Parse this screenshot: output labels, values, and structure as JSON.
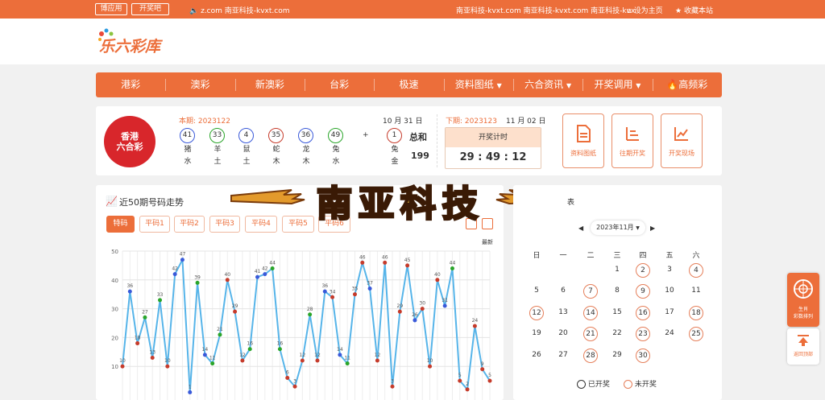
{
  "topbar": {
    "btn1": "博应用",
    "btn2": "开奖吧",
    "center_text": "z.com 南亚科技-kvxt.com",
    "right_text": "南亚科技-kvxt.com 南亚科技-kvxt.com 南亚科技-kvx",
    "set_home": "设为主页",
    "bookmark": "收藏本站"
  },
  "logo": {
    "text": "乐六彩库"
  },
  "nav": {
    "items": [
      "港彩",
      "澳彩",
      "新澳彩",
      "台彩",
      "极速",
      "资料图纸",
      "六合资讯",
      "开奖调用",
      "高频彩"
    ]
  },
  "draw": {
    "badge_line1": "香港",
    "badge_line2": "六合彩",
    "period_label": "本期: 2023122",
    "date": "10 月 31 日",
    "balls": [
      {
        "num": "41",
        "zodiac": "猪",
        "element": "水",
        "color": "blue"
      },
      {
        "num": "33",
        "zodiac": "羊",
        "element": "土",
        "color": "green"
      },
      {
        "num": "4",
        "zodiac": "鼠",
        "element": "土",
        "color": "blue"
      },
      {
        "num": "35",
        "zodiac": "蛇",
        "element": "木",
        "color": "red"
      },
      {
        "num": "36",
        "zodiac": "龙",
        "element": "木",
        "color": "blue"
      },
      {
        "num": "49",
        "zodiac": "兔",
        "element": "水",
        "color": "green"
      }
    ],
    "plus": "+",
    "special": {
      "num": "1",
      "zodiac": "兔",
      "element": "金",
      "color": "red"
    },
    "sum_label": "总和",
    "sum_value": "199",
    "next_period": "下期: 2023123",
    "next_date": "11 月 02 日",
    "countdown_label": "开奖计时",
    "countdown": "29 : 49 : 12"
  },
  "quick": [
    "资料图纸",
    "往期开奖",
    "开奖现场"
  ],
  "trend": {
    "title": "近50期号码走势",
    "tabs": [
      "特码",
      "平码1",
      "平码2",
      "平码3",
      "平码4",
      "平码5",
      "平码6"
    ],
    "latest": "最新"
  },
  "watermark": "南亚科技",
  "calendar": {
    "title_suffix": "表",
    "month": "2023年11月",
    "weekdays": [
      "日",
      "一",
      "二",
      "三",
      "四",
      "五",
      "六"
    ],
    "days": [
      [
        null,
        null,
        null,
        "1",
        "2",
        "3",
        "4"
      ],
      [
        "5",
        "6",
        "7",
        "8",
        "9",
        "10",
        "11"
      ],
      [
        "12",
        "13",
        "14",
        "15",
        "16",
        "17",
        "18"
      ],
      [
        "19",
        "20",
        "21",
        "22",
        "23",
        "24",
        "25"
      ],
      [
        "26",
        "27",
        "28",
        "29",
        "30",
        null,
        null
      ]
    ],
    "circled": [
      "2",
      "4",
      "7",
      "9",
      "12",
      "14",
      "16",
      "18",
      "21",
      "23",
      "25",
      "28",
      "30"
    ],
    "legend_open": "已开奖",
    "legend_pending": "未开奖"
  },
  "floats": {
    "item1_line1": "生肖",
    "item1_line2": "彩数排列",
    "item2": "返回顶部"
  },
  "chart_data": {
    "type": "line",
    "ylim": [
      0,
      50
    ],
    "yticks": [
      10,
      20,
      30,
      40,
      50
    ],
    "series": [
      {
        "values": [
          10,
          36,
          18,
          27,
          13,
          33,
          10,
          42,
          47,
          1,
          39,
          14,
          11,
          21,
          40,
          29,
          12,
          16,
          41,
          42,
          44,
          16,
          6,
          3,
          12,
          28,
          12,
          36,
          34,
          14,
          11,
          35,
          46,
          37,
          12,
          46,
          3,
          29,
          45,
          26,
          30,
          10,
          40,
          31,
          44,
          5,
          2,
          24,
          9,
          5
        ],
        "colors": [
          "red",
          "blue",
          "red",
          "green",
          "red",
          "green",
          "red",
          "blue",
          "blue",
          "blue",
          "green",
          "blue",
          "green",
          "green",
          "red",
          "red",
          "red",
          "green",
          "blue",
          "blue",
          "green",
          "green",
          "red",
          "red",
          "red",
          "green",
          "red",
          "blue",
          "red",
          "blue",
          "green",
          "red",
          "red",
          "blue",
          "red",
          "red",
          "red",
          "red",
          "red",
          "blue",
          "red",
          "red",
          "red",
          "blue",
          "green",
          "red",
          "red",
          "red",
          "red",
          "red"
        ]
      }
    ]
  }
}
